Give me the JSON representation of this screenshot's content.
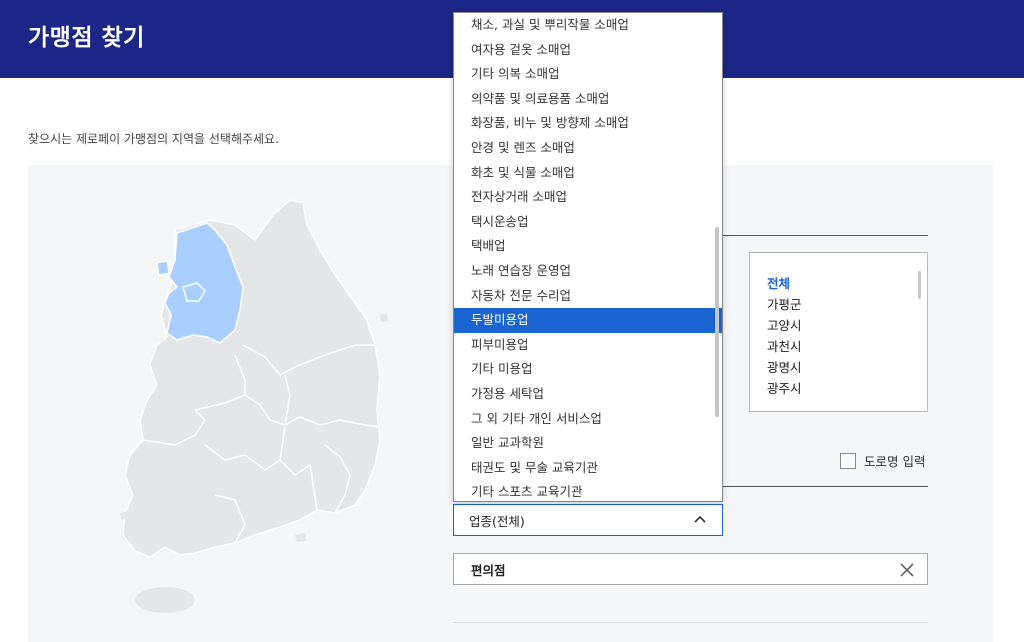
{
  "header": {
    "title": "가맹점 찾기"
  },
  "instruction": "찾으시는 제로페이 가맹점의 지역을 선택해주세요.",
  "colors": {
    "header_bg": "#1c2686",
    "accent": "#1a64d2",
    "map_highlight": "#a8cfff",
    "map_default": "#e5e6e8"
  },
  "map": {
    "selected_region": "경기도"
  },
  "business_type_options": [
    "채소, 과실 및 뿌리작물 소매업",
    "여자용 겉옷 소매업",
    "기타 의복 소매업",
    "의약품 및 의료용품 소매업",
    "화장품, 비누 및 방향제 소매업",
    "안경 및 렌즈 소매업",
    "화초 및 식물 소매업",
    "전자상거래 소매업",
    "택시운송업",
    "택배업",
    "노래 연습장 운영업",
    "자동차 전문 수리업",
    "두발미용업",
    "피부미용업",
    "기타 미용업",
    "가정용 세탁업",
    "그 외 기타 개인 서비스업",
    "일반 교과학원",
    "태권도 및 무술 교육기관",
    "기타 스포츠 교육기관"
  ],
  "highlighted_option_index": 12,
  "city_list": [
    "전체",
    "가평군",
    "고양시",
    "과천시",
    "광명시",
    "광주시"
  ],
  "city_active_index": 0,
  "road_name": {
    "label": "도로명 입력",
    "checked": false
  },
  "business_select": {
    "label": "업종(전체)",
    "icon": "chevron-up-icon"
  },
  "search": {
    "value": "편의점",
    "clear_icon": "close-icon"
  }
}
